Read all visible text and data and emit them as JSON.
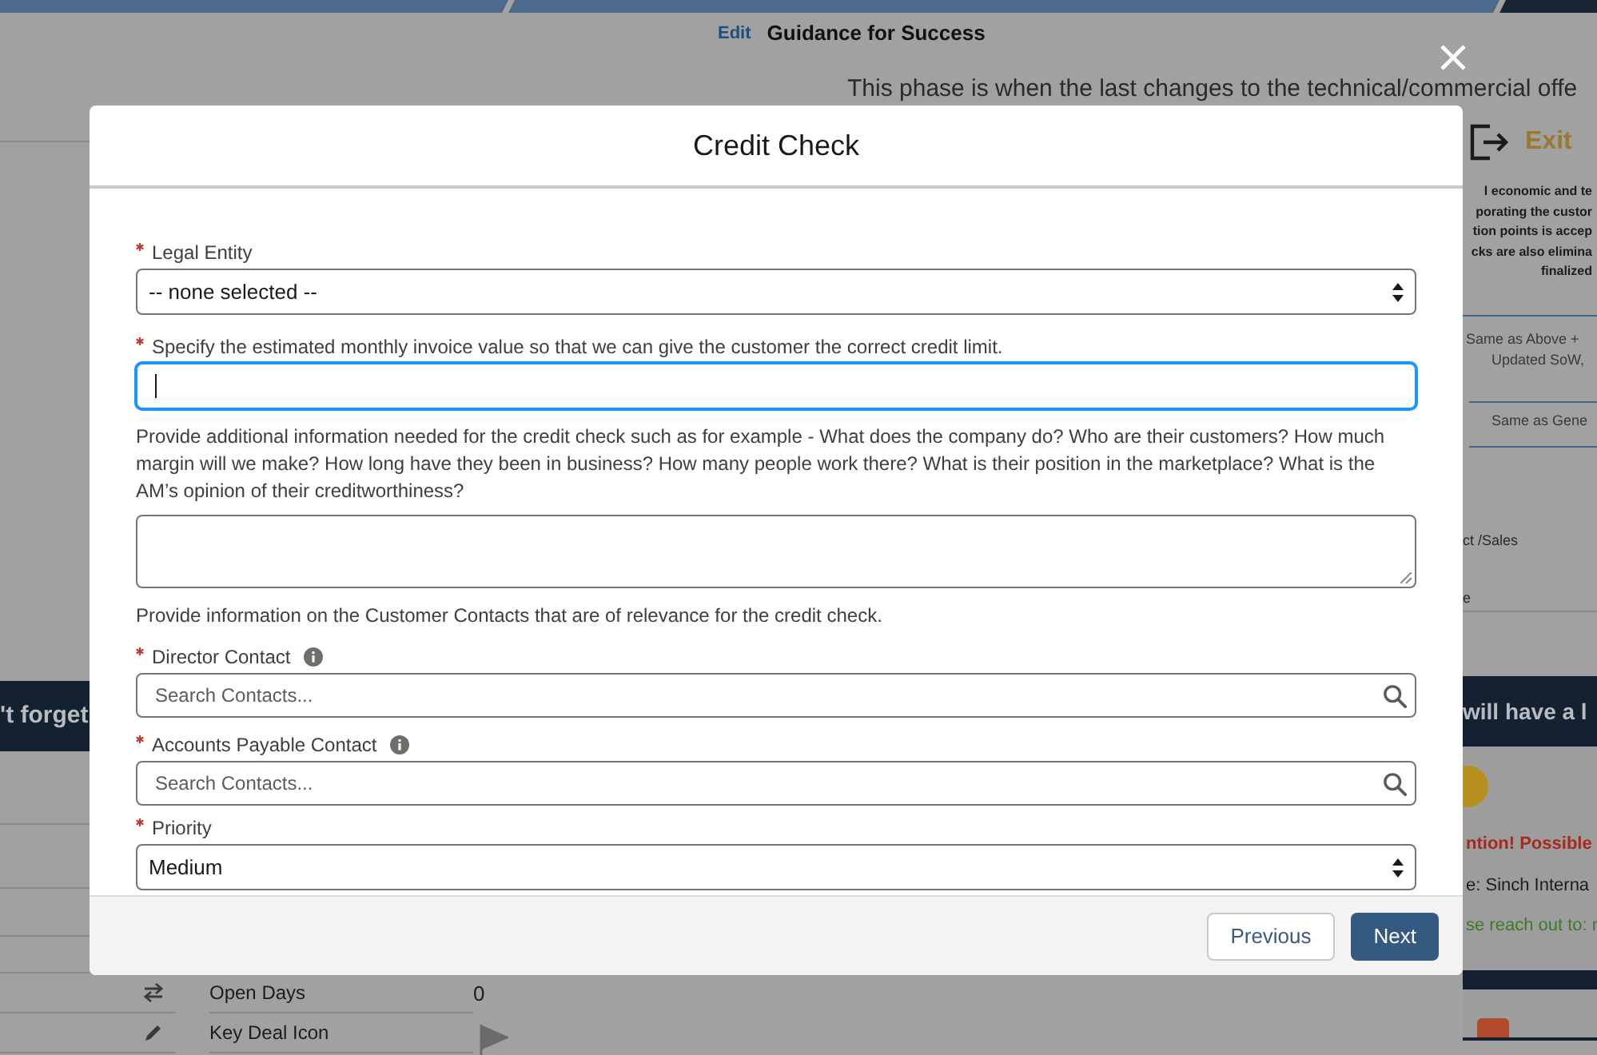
{
  "header": {
    "edit_link": "Edit",
    "title": "Guidance for Success"
  },
  "phase_text": "This phase is when the last changes to the technical/commercial offe",
  "left_panel": {
    "banner": "'t forget",
    "fields": [
      {
        "kind": "number",
        "label": "Open Days",
        "value": "0"
      },
      {
        "kind": "flag",
        "label": "Key Deal Icon"
      }
    ]
  },
  "right_panel": {
    "exit": "Exit",
    "description_lines": [
      "l economic and te",
      "porating the custor",
      "tion points is accep",
      "cks are also elimina",
      "finalized"
    ],
    "notes": [
      "Same as Above +",
      "Updated SoW,",
      "Same as Gene"
    ],
    "role": "ct /Sales",
    "role_2": "e",
    "banner": "will have a l",
    "alert": "ntion! Possible",
    "account": "e: Sinch Interna",
    "contact_hint": "se reach out to: r"
  },
  "modal": {
    "title": "Credit Check",
    "fields": [
      {
        "kind": "select",
        "required": true,
        "label": "Legal Entity",
        "value": "-- none selected --"
      },
      {
        "kind": "input",
        "required": true,
        "label": "Specify the estimated monthly invoice value so that we can give the customer the correct credit limit.",
        "focused": true
      },
      {
        "kind": "textarea",
        "label": "Provide additional information needed for the credit check such as for example - What does the company do? Who are their customers? How much margin will we make? How long have they been in business? How many people work there? What is their position in the marketplace? What is the AM’s opinion of their creditworthiness?"
      },
      {
        "kind": "note",
        "label": "Provide information on the Customer Contacts that are of relevance for the credit check."
      },
      {
        "kind": "lookup",
        "required": true,
        "label": "Director Contact",
        "info": true,
        "placeholder": "Search Contacts..."
      },
      {
        "kind": "lookup",
        "required": true,
        "label": "Accounts Payable Contact",
        "info": true,
        "placeholder": "Search Contacts..."
      },
      {
        "kind": "select",
        "required": true,
        "label": "Priority",
        "value": "Medium"
      }
    ],
    "buttons": [
      {
        "label": "Previous",
        "kind": "neutral"
      },
      {
        "label": "Next",
        "kind": "brand"
      }
    ]
  }
}
